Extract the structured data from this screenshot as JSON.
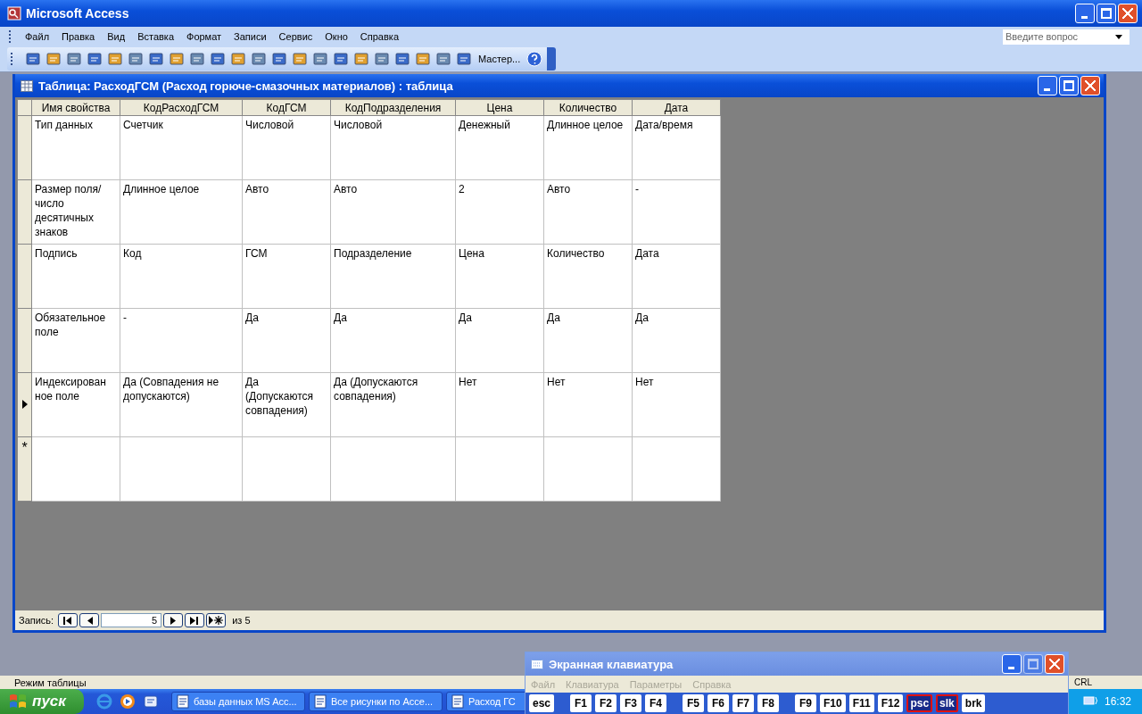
{
  "window": {
    "title": "Microsoft Access"
  },
  "menu": [
    "Файл",
    "Правка",
    "Вид",
    "Вставка",
    "Формат",
    "Записи",
    "Сервис",
    "Окно",
    "Справка"
  ],
  "help_search": {
    "placeholder": "Введите вопрос"
  },
  "toolbar": {
    "wizard_label": "Мастер..."
  },
  "table_window": {
    "title": "Таблица: РасходГСМ (Расход горюче-смазочных материалов) : таблица",
    "columns": [
      "Имя свойства",
      "КодРасходГСМ",
      "КодГСМ",
      "КодПодразделения",
      "Цена",
      "Количество",
      "Дата"
    ],
    "rows": [
      {
        "current": false,
        "cells": [
          "Тип данных",
          "Счетчик",
          "Числовой",
          "Числовой",
          "Денежный",
          "Длинное целое",
          "Дата/время"
        ]
      },
      {
        "current": false,
        "cells": [
          "Размер поля/ число десятичных знаков",
          "Длинное целое",
          "Авто",
          "Авто",
          "2",
          "Авто",
          "-"
        ]
      },
      {
        "current": false,
        "cells": [
          "Подпись",
          "Код",
          "ГСМ",
          "Подразделение",
          "Цена",
          "Количество",
          "Дата"
        ]
      },
      {
        "current": false,
        "cells": [
          "Обязательное поле",
          "-",
          "Да",
          "Да",
          "Да",
          "Да",
          "Да"
        ]
      },
      {
        "current": true,
        "cells": [
          "Индексирован ное поле",
          "Да (Совпадения не допускаются)",
          "Да (Допускаются совпадения)",
          "Да (Допускаются совпадения)",
          "Нет",
          "Нет",
          "Нет"
        ]
      }
    ],
    "new_row_marker": "*"
  },
  "navigator": {
    "label": "Запись:",
    "record": "5",
    "total": "из 5"
  },
  "status_bar": {
    "text": "Режим таблицы",
    "indicator": "CRL"
  },
  "taskbar": {
    "start": "пуск",
    "tasks": [
      {
        "label": "базы данных MS Acc...",
        "selected": false
      },
      {
        "label": "Все рисунки по Acce...",
        "selected": false
      },
      {
        "label": "Расход ГС",
        "selected": false
      }
    ],
    "clock": "16:32"
  },
  "keyboard": {
    "title": "Экранная клавиатура",
    "menu": [
      "Файл",
      "Клавиатура",
      "Параметры",
      "Справка"
    ],
    "key_groups": [
      [
        {
          "label": "esc",
          "selected": false
        }
      ],
      [
        {
          "label": "F1",
          "selected": false
        },
        {
          "label": "F2",
          "selected": false
        },
        {
          "label": "F3",
          "selected": false
        },
        {
          "label": "F4",
          "selected": false
        }
      ],
      [
        {
          "label": "F5",
          "selected": false
        },
        {
          "label": "F6",
          "selected": false
        },
        {
          "label": "F7",
          "selected": false
        },
        {
          "label": "F8",
          "selected": false
        }
      ],
      [
        {
          "label": "F9",
          "selected": false
        },
        {
          "label": "F10",
          "selected": false
        },
        {
          "label": "F11",
          "selected": false
        },
        {
          "label": "F12",
          "selected": false
        },
        {
          "label": "psc",
          "selected": true
        },
        {
          "label": "slk",
          "selected": true
        },
        {
          "label": "brk",
          "selected": false
        }
      ]
    ]
  }
}
